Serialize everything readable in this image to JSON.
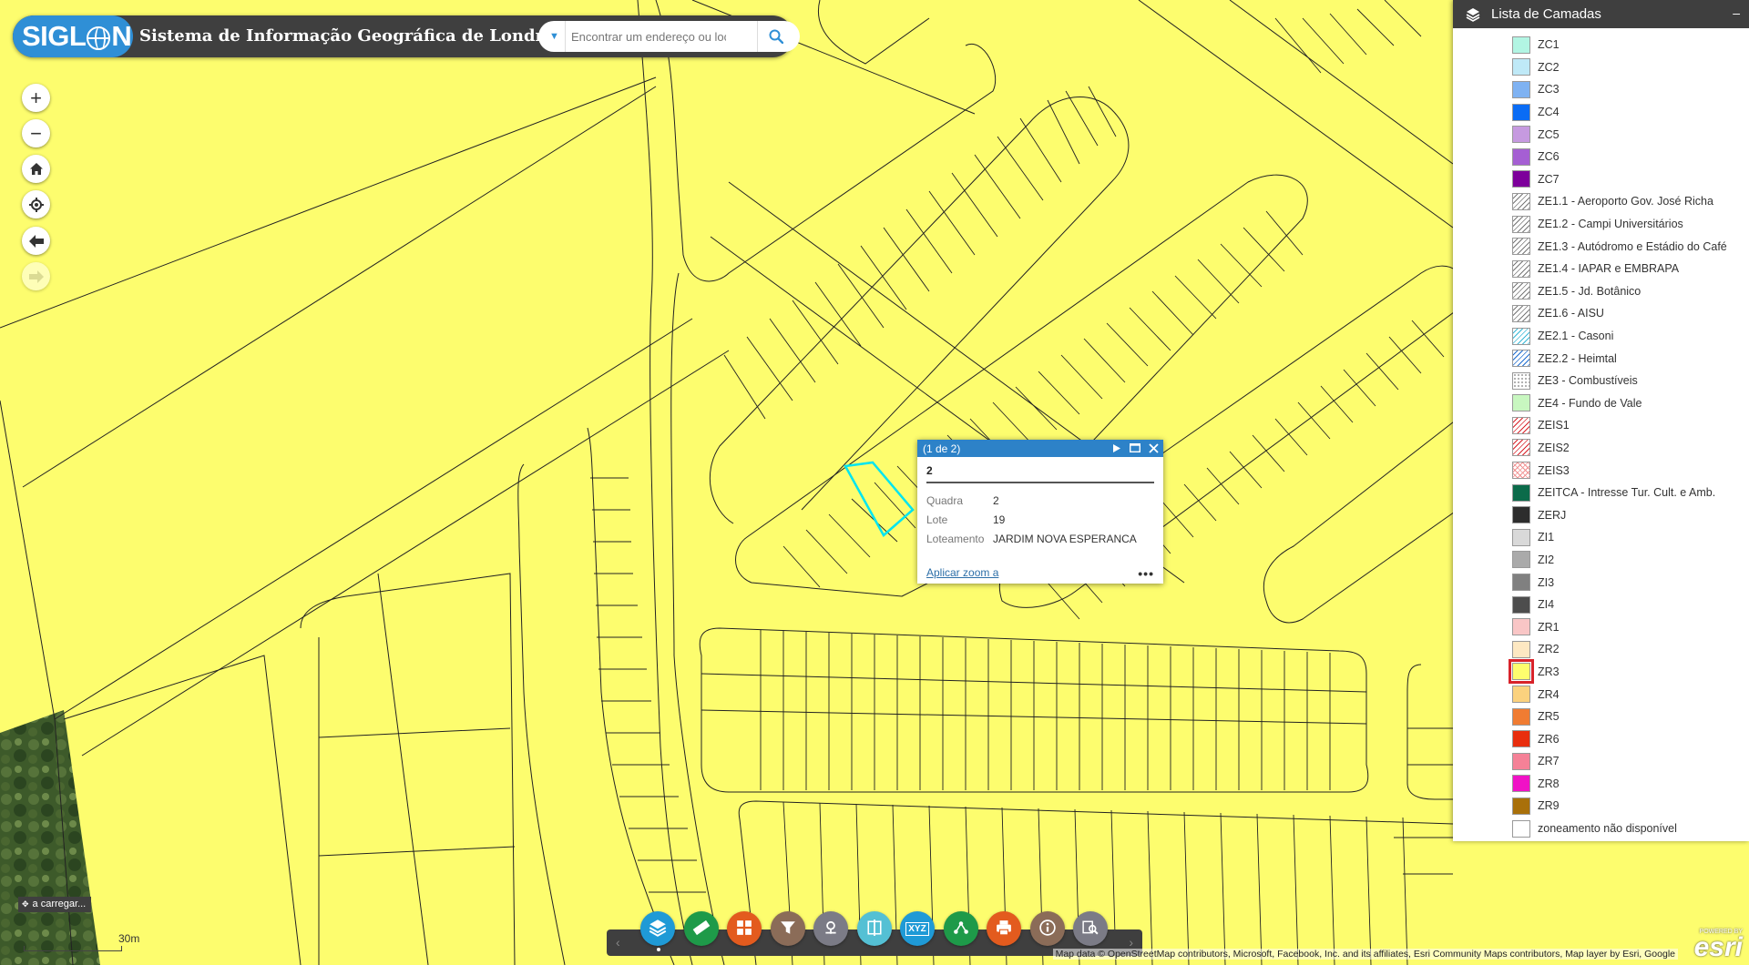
{
  "header": {
    "logo_text": "SIGLON",
    "app_title": "Sistema de Informação Geográfica de Londrina",
    "search_placeholder": "Encontrar um endereço ou local"
  },
  "map_controls": [
    "zoom-in",
    "zoom-out",
    "home",
    "locate",
    "previous-extent",
    "next-extent"
  ],
  "popup": {
    "counter": "(1 de 2)",
    "title": "2",
    "attributes": [
      {
        "key": "Quadra",
        "value": "2"
      },
      {
        "key": "Lote",
        "value": "19"
      },
      {
        "key": "Loteamento",
        "value": "JARDIM NOVA ESPERANCA"
      }
    ],
    "zoom_link": "Aplicar zoom a",
    "more": "•••"
  },
  "layer_panel": {
    "title": "Lista de Camadas",
    "items": [
      {
        "label": "ZC1",
        "color": "#b2f5e3",
        "pattern": "solid"
      },
      {
        "label": "ZC2",
        "color": "#bfe9f7",
        "pattern": "solid"
      },
      {
        "label": "ZC3",
        "color": "#7fb2f2",
        "pattern": "solid"
      },
      {
        "label": "ZC4",
        "color": "#0a6cf5",
        "pattern": "solid"
      },
      {
        "label": "ZC5",
        "color": "#c69ae0",
        "pattern": "solid"
      },
      {
        "label": "ZC6",
        "color": "#a55fd3",
        "pattern": "solid"
      },
      {
        "label": "ZC7",
        "color": "#7d009b",
        "pattern": "solid"
      },
      {
        "label": "ZE1.1 - Aeroporto Gov. José Richa",
        "color": "#777777",
        "pattern": "hatch"
      },
      {
        "label": "ZE1.2 - Campi Universitários",
        "color": "#777777",
        "pattern": "hatch"
      },
      {
        "label": "ZE1.3 - Autódromo e Estádio do Café",
        "color": "#777777",
        "pattern": "hatch"
      },
      {
        "label": "ZE1.4 - IAPAR e EMBRAPA",
        "color": "#777777",
        "pattern": "hatch"
      },
      {
        "label": "ZE1.5 - Jd. Botânico",
        "color": "#777777",
        "pattern": "hatch"
      },
      {
        "label": "ZE1.6 - AISU",
        "color": "#777777",
        "pattern": "hatch"
      },
      {
        "label": "ZE2.1 - Casoni",
        "color": "#39b8d6",
        "pattern": "hatch"
      },
      {
        "label": "ZE2.2 - Heimtal",
        "color": "#1f6dcf",
        "pattern": "hatch"
      },
      {
        "label": "ZE3 - Combustíveis",
        "color": "#999999",
        "pattern": "dots"
      },
      {
        "label": "ZE4 - Fundo de Vale",
        "color": "#c8f7c0",
        "pattern": "solid"
      },
      {
        "label": "ZEIS1",
        "color": "#d8232a",
        "pattern": "hatch"
      },
      {
        "label": "ZEIS2",
        "color": "#d8232a",
        "pattern": "hatch"
      },
      {
        "label": "ZEIS3",
        "color": "#f09090",
        "pattern": "cross"
      },
      {
        "label": "ZEITCA - Intresse Tur. Cult. e Amb.",
        "color": "#0b6b4a",
        "pattern": "solid"
      },
      {
        "label": "ZERJ",
        "color": "#2d2d2d",
        "pattern": "solid"
      },
      {
        "label": "ZI1",
        "color": "#d9d9d9",
        "pattern": "solid"
      },
      {
        "label": "ZI2",
        "color": "#aaaaaa",
        "pattern": "solid"
      },
      {
        "label": "ZI3",
        "color": "#808080",
        "pattern": "solid"
      },
      {
        "label": "ZI4",
        "color": "#4d4d4d",
        "pattern": "solid"
      },
      {
        "label": "ZR1",
        "color": "#f9c6c6",
        "pattern": "solid"
      },
      {
        "label": "ZR2",
        "color": "#fde8c2",
        "pattern": "solid"
      },
      {
        "label": "ZR3",
        "color": "#fdfd6e",
        "pattern": "solid",
        "highlighted": true
      },
      {
        "label": "ZR4",
        "color": "#fbd27e",
        "pattern": "solid"
      },
      {
        "label": "ZR5",
        "color": "#f07c32",
        "pattern": "solid"
      },
      {
        "label": "ZR6",
        "color": "#e82e0e",
        "pattern": "solid"
      },
      {
        "label": "ZR7",
        "color": "#f58197",
        "pattern": "solid"
      },
      {
        "label": "ZR8",
        "color": "#f012c6",
        "pattern": "solid"
      },
      {
        "label": "ZR9",
        "color": "#a9700a",
        "pattern": "solid"
      },
      {
        "label": "zoneamento não disponível",
        "color": "#ffffff",
        "pattern": "solid"
      }
    ]
  },
  "toolbar": {
    "tools": [
      {
        "name": "layer-list",
        "color": "#1f9ad6"
      },
      {
        "name": "measure",
        "color": "#1e9a49"
      },
      {
        "name": "basemap-gallery",
        "color": "#e35b1e"
      },
      {
        "name": "filter",
        "color": "#8b6c58"
      },
      {
        "name": "geo-locate",
        "color": "#7b7b86"
      },
      {
        "name": "swipe",
        "color": "#54c0d4"
      },
      {
        "name": "coordinates",
        "color": "#1f9ad6",
        "text": "XYZ"
      },
      {
        "name": "share",
        "color": "#1e9a49"
      },
      {
        "name": "print",
        "color": "#e35b1e"
      },
      {
        "name": "about",
        "color": "#8b6c58"
      },
      {
        "name": "query",
        "color": "#7b7b86"
      }
    ]
  },
  "status": {
    "loading_text": "a carregar...",
    "scale_label": "30m",
    "attribution": "Map data © OpenStreetMap contributors, Microsoft, Facebook, Inc. and its affiliates, Esri Community Maps contributors, Map layer by Esri, Google",
    "esri_powered": "POWERED BY",
    "esri_logo": "esri"
  },
  "colors": {
    "zone_fill": "#fdfd6e",
    "header_bg": "#3f3f3f",
    "accent": "#2d82c8",
    "selection": "#00e5f0"
  }
}
